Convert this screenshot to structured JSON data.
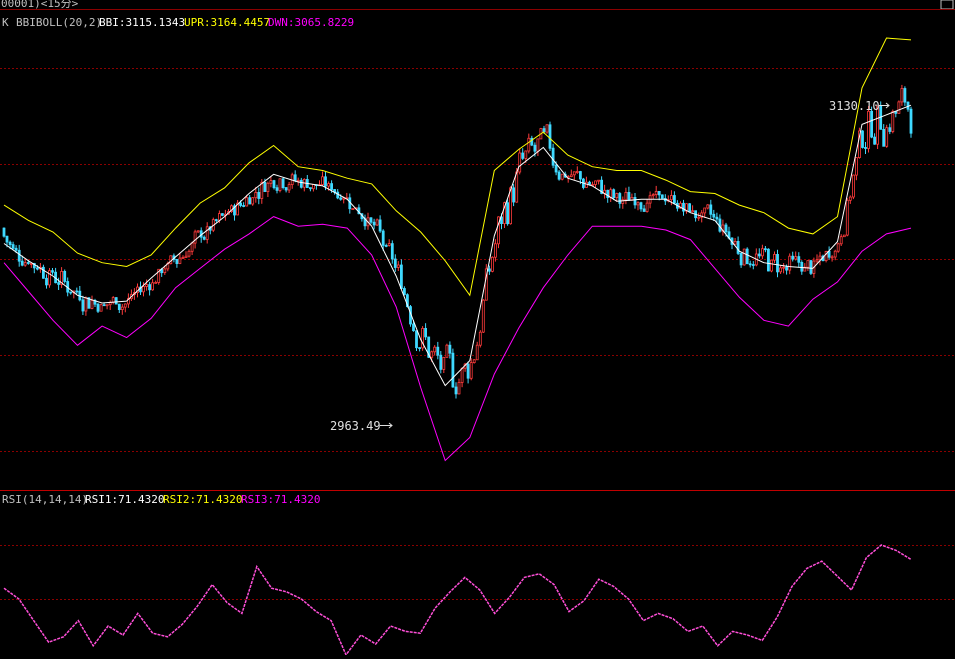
{
  "header": {
    "instrument": "00001)<15分>"
  },
  "main_legend": {
    "kind": "K",
    "indicator": "BBIBOLL(20,2)",
    "bbi": "BBI:3115.1343",
    "upr": "UPR:3164.4457",
    "dwn": "DWN:3065.8229"
  },
  "rsi_legend": {
    "name": "RSI(14,14,14)",
    "rsi1": "RSI1:71.4320",
    "rsi2": "RSI2:71.4320",
    "rsi3": "RSI3:71.4320"
  },
  "annotations": {
    "high_label": "3130.10",
    "low_label": "2963.49"
  },
  "colors": {
    "background": "#000000",
    "grid": "#8b0000",
    "up_candle": "#ff3b3b",
    "down_candle": "#3fd9ff",
    "bbi": "#ffffff",
    "upper_band": "#ffff00",
    "lower_band": "#ff00ff",
    "rsi": "#ff4fd8",
    "text": "#c0c0c0"
  },
  "chart_data": [
    {
      "type": "candlestick",
      "interval": "15分",
      "indicator": "BBIBOLL(20,2)",
      "series": [
        {
          "name": "BBI",
          "values": [
            3058,
            3049,
            3041,
            3031,
            3027,
            3028,
            3040,
            3051,
            3062,
            3072,
            3084,
            3094,
            3090,
            3088,
            3081,
            3067,
            3041,
            3008,
            2984,
            2997,
            3062,
            3098,
            3108,
            3092,
            3088,
            3080,
            3081,
            3081,
            3074,
            3070,
            3054,
            3048,
            3046,
            3045,
            3059,
            3120,
            3125,
            3130
          ]
        },
        {
          "name": "UPR",
          "values": [
            3078,
            3070,
            3064,
            3053,
            3048,
            3046,
            3052,
            3066,
            3079,
            3087,
            3100,
            3109,
            3098,
            3096,
            3092,
            3089,
            3075,
            3064,
            3049,
            3031,
            3096,
            3107,
            3116,
            3104,
            3098,
            3096,
            3096,
            3091,
            3085,
            3084,
            3078,
            3074,
            3066,
            3063,
            3072,
            3139,
            3165,
            3164
          ]
        },
        {
          "name": "DWN",
          "values": [
            3048,
            3033,
            3018,
            3005,
            3015,
            3009,
            3019,
            3035,
            3045,
            3055,
            3063,
            3072,
            3067,
            3068,
            3066,
            3052,
            3025,
            2983,
            2945,
            2957,
            2990,
            3014,
            3035,
            3052,
            3067,
            3067,
            3067,
            3065,
            3060,
            3045,
            3030,
            3018,
            3015,
            3029,
            3038,
            3054,
            3063,
            3066
          ]
        }
      ],
      "annotations": [
        {
          "label": "3130.10",
          "type": "high"
        },
        {
          "label": "2963.49",
          "type": "low"
        }
      ]
    },
    {
      "type": "line",
      "indicator": "RSI(14,14,14)",
      "ylim": [
        0,
        100
      ],
      "gridlines": [
        80,
        50,
        20
      ],
      "series": [
        {
          "name": "RSI",
          "values": [
            56,
            50,
            38,
            26,
            29,
            38,
            24,
            35,
            30,
            42,
            31,
            29,
            36,
            46,
            58,
            48,
            42,
            68,
            56,
            54,
            50,
            43,
            38,
            19,
            30,
            25,
            35,
            32,
            31,
            45,
            54,
            62,
            55,
            42,
            51,
            62,
            64,
            58,
            43,
            49,
            61,
            57,
            50,
            38,
            42,
            39,
            32,
            35,
            24,
            32,
            30,
            27,
            40,
            57,
            67,
            71,
            63,
            55,
            73,
            80,
            77,
            72
          ]
        }
      ],
      "current": {
        "RSI1": 71.432,
        "RSI2": 71.432,
        "RSI3": 71.432
      }
    }
  ]
}
